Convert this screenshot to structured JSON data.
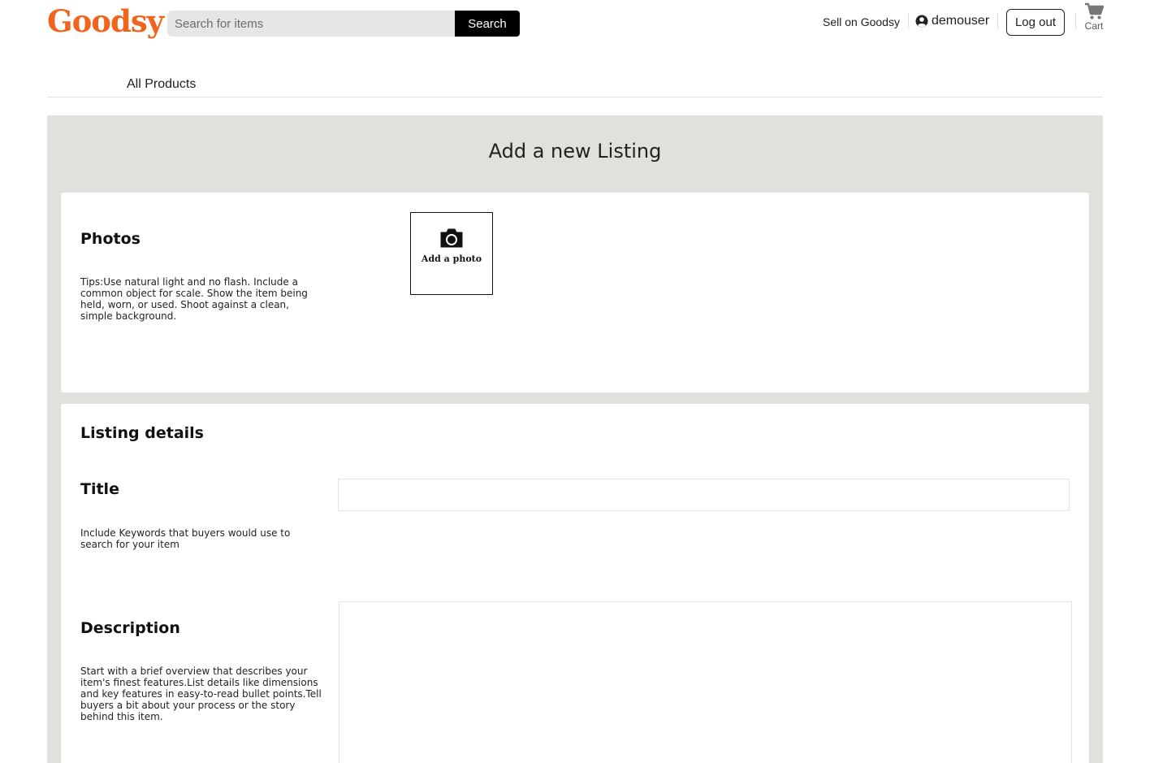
{
  "header": {
    "logo": "Goodsy",
    "search": {
      "placeholder": "Search for items",
      "button_label": "Search"
    },
    "sell_link": "Sell on Goodsy",
    "username": "demouser",
    "logout_label": "Log out",
    "cart_label": "Cart"
  },
  "nav": {
    "items": [
      {
        "label": "All Products"
      }
    ]
  },
  "page": {
    "title": "Add a new Listing"
  },
  "photos": {
    "title": "Photos",
    "tips": "Tips:Use natural light and no flash. Include a common object for scale. Show the item being held, worn, or used. Shoot against a clean, simple background.",
    "add_label": "Add a photo"
  },
  "details": {
    "title": "Listing details",
    "title_field": {
      "label": "Title",
      "help": "Include Keywords that buyers would use to search for your item",
      "value": ""
    },
    "description_field": {
      "label": "Description",
      "help": "Start with a brief overview that describes your item's finest features.List details like dimensions and key features in easy-to-read bullet points.Tell buyers a bit about your process or the story behind this item.",
      "value": ""
    }
  },
  "colors": {
    "brand": "#f1641e",
    "panel_bg": "#e0e1dc",
    "search_button_bg": "#000000"
  },
  "icons": [
    "user-circle-icon",
    "cart-icon",
    "camera-icon"
  ]
}
